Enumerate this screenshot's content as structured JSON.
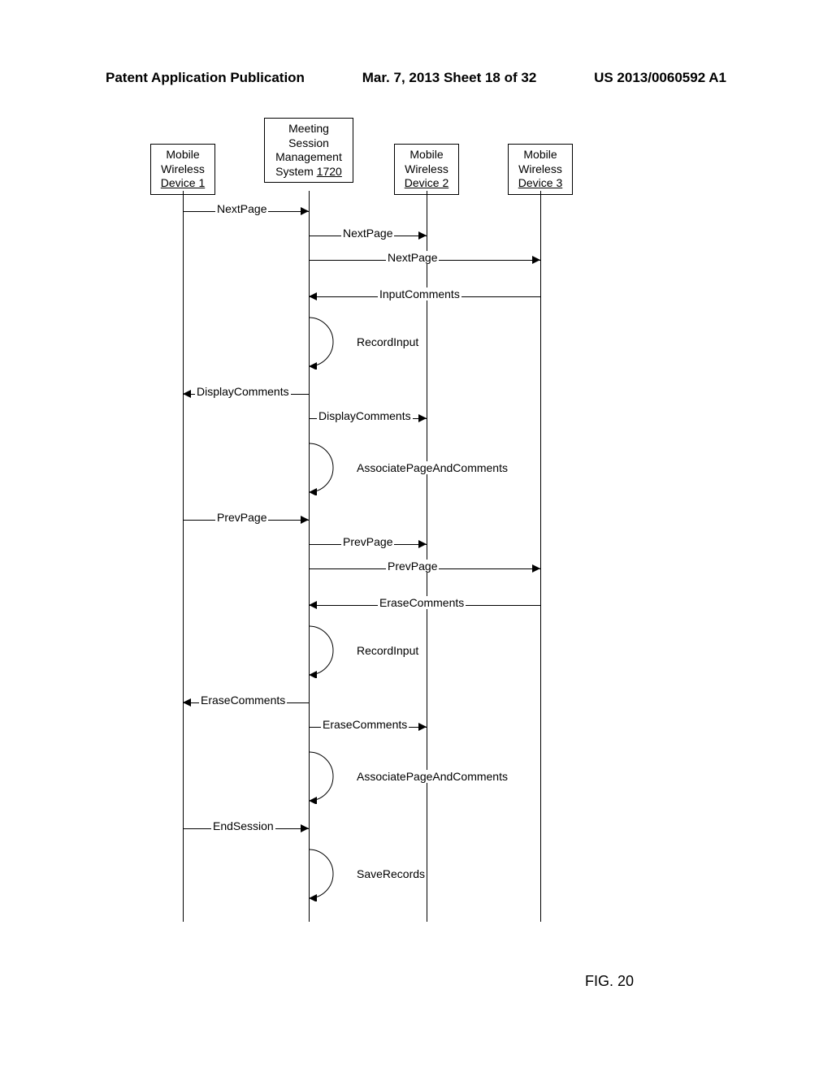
{
  "header": {
    "left": "Patent Application Publication",
    "center": "Mar. 7, 2013  Sheet 18 of 32",
    "right": "US 2013/0060592 A1"
  },
  "figure_label": "FIG. 20",
  "lifelines": {
    "l1": {
      "line1": "Mobile",
      "line2": "Wireless",
      "line3": "Device 1"
    },
    "l2": {
      "line1": "Meeting",
      "line2": "Session",
      "line3": "Management",
      "line4": "System ",
      "ref": "1720"
    },
    "l3": {
      "line1": "Mobile",
      "line2": "Wireless",
      "line3": "Device 2"
    },
    "l4": {
      "line1": "Mobile",
      "line2": "Wireless",
      "line3": "Device 3"
    }
  },
  "messages": {
    "m1": "NextPage",
    "m2": "NextPage",
    "m3": "NextPage",
    "m4": "InputComments",
    "m5": "RecordInput",
    "m6": "DisplayComments",
    "m7": "DisplayComments",
    "m8": "AssociatePageAndComments",
    "m9": "PrevPage",
    "m10": "PrevPage",
    "m11": "PrevPage",
    "m12": "EraseComments",
    "m13": "RecordInput",
    "m14": "EraseComments",
    "m15": "EraseComments",
    "m16": "AssociatePageAndComments",
    "m17": "EndSession",
    "m18": "SaveRecords"
  }
}
